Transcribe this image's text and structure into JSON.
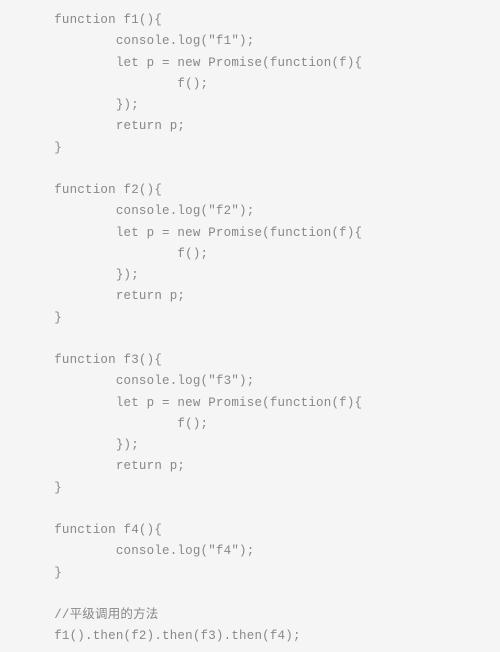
{
  "code": {
    "lines": [
      "      function f1(){",
      "              console.log(\"f1\");",
      "              let p = new Promise(function(f){",
      "                      f();",
      "              });",
      "              return p;",
      "      }",
      "",
      "      function f2(){",
      "              console.log(\"f2\");",
      "              let p = new Promise(function(f){",
      "                      f();",
      "              });",
      "              return p;",
      "      }",
      "",
      "      function f3(){",
      "              console.log(\"f3\");",
      "              let p = new Promise(function(f){",
      "                      f();",
      "              });",
      "              return p;",
      "      }",
      "",
      "      function f4(){",
      "              console.log(\"f4\");",
      "      }",
      "",
      "      //平级调用的方法",
      "      f1().then(f2).then(f3).then(f4);"
    ]
  }
}
